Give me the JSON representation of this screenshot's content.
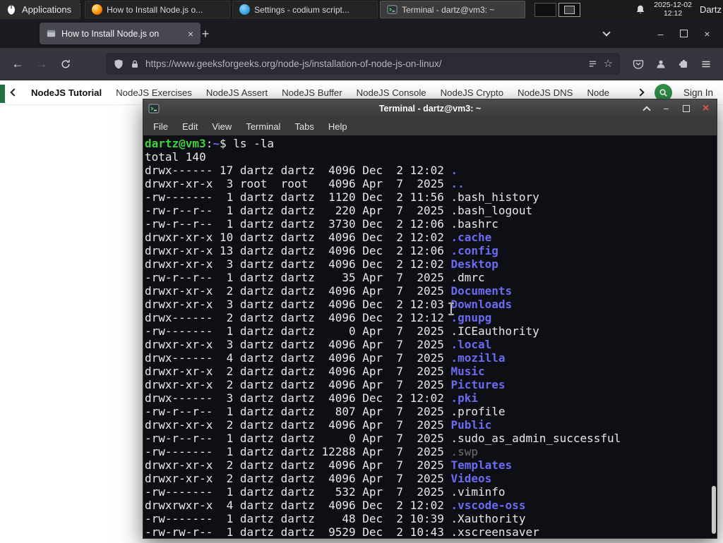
{
  "colors": {
    "gfg_green": "#2f8d46",
    "dir_blue": "#6b6bf0",
    "prompt_green": "#3fd23f",
    "close_orange": "#e2574c",
    "panel_bg": "#1b1b1b",
    "terminal_bg": "#0e0e15"
  },
  "panel": {
    "applications": "Applications",
    "tasks": [
      {
        "title": "How to Install Node.js o...",
        "icon": "firefox-icon"
      },
      {
        "title": "Settings - codium script...",
        "icon": "codium-icon"
      },
      {
        "title": "Terminal - dartz@vm3: ~",
        "icon": "terminal-icon"
      }
    ],
    "date": "2025-12-02",
    "time": "12:12",
    "user": "Dartz"
  },
  "browser": {
    "tab": "How to Install Node.js on",
    "new_tab": "+",
    "tab_close": "×",
    "url": "https://www.geeksforgeeks.org/node-js/installation-of-node-js-on-linux/",
    "star": "☆",
    "nav_items": [
      "NodeJS Tutorial",
      "NodeJS Exercises",
      "NodeJS Assert",
      "NodeJS Buffer",
      "NodeJS Console",
      "NodeJS Crypto",
      "NodeJS DNS",
      "Node"
    ],
    "sign_in": "Sign In",
    "back_arrow": "←",
    "forward_arrow": "→",
    "minimize": "–",
    "close": "×"
  },
  "terminal": {
    "title": "Terminal - dartz@vm3: ~",
    "menu": [
      "File",
      "Edit",
      "View",
      "Terminal",
      "Tabs",
      "Help"
    ],
    "minimize": "−",
    "close": "×",
    "prompt": {
      "user_host": "dartz@vm3",
      "colon": ":",
      "cwd": "~",
      "dollar": "$ ",
      "command": "ls -la"
    },
    "total": "total 140",
    "listing": [
      {
        "pre": "drwx------ 17 dartz dartz  4096 Dec  2 12:02 ",
        "name": ".",
        "type": "dir"
      },
      {
        "pre": "drwxr-xr-x  3 root  root   4096 Apr  7  2025 ",
        "name": "..",
        "type": "dir"
      },
      {
        "pre": "-rw-------  1 dartz dartz  1120 Dec  2 11:56 ",
        "name": ".bash_history",
        "type": "file"
      },
      {
        "pre": "-rw-r--r--  1 dartz dartz   220 Apr  7  2025 ",
        "name": ".bash_logout",
        "type": "file"
      },
      {
        "pre": "-rw-r--r--  1 dartz dartz  3730 Dec  2 12:06 ",
        "name": ".bashrc",
        "type": "file"
      },
      {
        "pre": "drwxr-xr-x 10 dartz dartz  4096 Dec  2 12:02 ",
        "name": ".cache",
        "type": "dir"
      },
      {
        "pre": "drwxr-xr-x 13 dartz dartz  4096 Dec  2 12:06 ",
        "name": ".config",
        "type": "dir"
      },
      {
        "pre": "drwxr-xr-x  3 dartz dartz  4096 Dec  2 12:02 ",
        "name": "Desktop",
        "type": "dir"
      },
      {
        "pre": "-rw-r--r--  1 dartz dartz    35 Apr  7  2025 ",
        "name": ".dmrc",
        "type": "file"
      },
      {
        "pre": "drwxr-xr-x  2 dartz dartz  4096 Apr  7  2025 ",
        "name": "Documents",
        "type": "dir"
      },
      {
        "pre": "drwxr-xr-x  3 dartz dartz  4096 Dec  2 12:03 ",
        "name": "Downloads",
        "type": "dir"
      },
      {
        "pre": "drwx------  2 dartz dartz  4096 Dec  2 12:12 ",
        "name": ".gnupg",
        "type": "dir"
      },
      {
        "pre": "-rw-------  1 dartz dartz     0 Apr  7  2025 ",
        "name": ".ICEauthority",
        "type": "file"
      },
      {
        "pre": "drwxr-xr-x  3 dartz dartz  4096 Apr  7  2025 ",
        "name": ".local",
        "type": "dir"
      },
      {
        "pre": "drwx------  4 dartz dartz  4096 Apr  7  2025 ",
        "name": ".mozilla",
        "type": "dir"
      },
      {
        "pre": "drwxr-xr-x  2 dartz dartz  4096 Apr  7  2025 ",
        "name": "Music",
        "type": "dir"
      },
      {
        "pre": "drwxr-xr-x  2 dartz dartz  4096 Apr  7  2025 ",
        "name": "Pictures",
        "type": "dir"
      },
      {
        "pre": "drwx------  3 dartz dartz  4096 Dec  2 12:02 ",
        "name": ".pki",
        "type": "dir"
      },
      {
        "pre": "-rw-r--r--  1 dartz dartz   807 Apr  7  2025 ",
        "name": ".profile",
        "type": "file"
      },
      {
        "pre": "drwxr-xr-x  2 dartz dartz  4096 Apr  7  2025 ",
        "name": "Public",
        "type": "dir"
      },
      {
        "pre": "-rw-r--r--  1 dartz dartz     0 Apr  7  2025 ",
        "name": ".sudo_as_admin_successful",
        "type": "file"
      },
      {
        "pre": "-rw-------  1 dartz dartz 12288 Apr  7  2025 ",
        "name": ".swp",
        "type": "dim"
      },
      {
        "pre": "drwxr-xr-x  2 dartz dartz  4096 Apr  7  2025 ",
        "name": "Templates",
        "type": "dir"
      },
      {
        "pre": "drwxr-xr-x  2 dartz dartz  4096 Apr  7  2025 ",
        "name": "Videos",
        "type": "dir"
      },
      {
        "pre": "-rw-------  1 dartz dartz   532 Apr  7  2025 ",
        "name": ".viminfo",
        "type": "file"
      },
      {
        "pre": "drwxrwxr-x  4 dartz dartz  4096 Dec  2 12:02 ",
        "name": ".vscode-oss",
        "type": "dir"
      },
      {
        "pre": "-rw-------  1 dartz dartz    48 Dec  2 10:39 ",
        "name": ".Xauthority",
        "type": "file"
      },
      {
        "pre": "-rw-rw-r--  1 dartz dartz  9529 Dec  2 10:43 ",
        "name": ".xscreensaver",
        "type": "file"
      }
    ]
  }
}
